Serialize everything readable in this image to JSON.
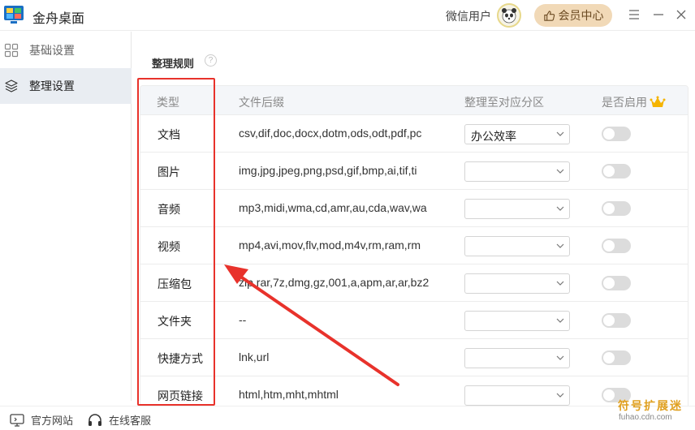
{
  "app": {
    "title": "金舟桌面"
  },
  "header": {
    "user_name": "微信用户",
    "vip_label": "会员中心"
  },
  "sidebar": {
    "items": [
      {
        "label": "基础设置",
        "icon": "grid-icon",
        "active": false
      },
      {
        "label": "整理设置",
        "icon": "layers-icon",
        "active": true
      }
    ]
  },
  "main": {
    "section_title": "整理规则",
    "columns": {
      "type": "类型",
      "ext": "文件后缀",
      "zone": "整理至对应分区",
      "enabled": "是否启用"
    },
    "rows": [
      {
        "type": "文档",
        "ext": "csv,dif,doc,docx,dotm,ods,odt,pdf,pc",
        "zone": "办公效率",
        "enabled": false
      },
      {
        "type": "图片",
        "ext": "img,jpg,jpeg,png,psd,gif,bmp,ai,tif,ti",
        "zone": "",
        "enabled": false
      },
      {
        "type": "音频",
        "ext": "mp3,midi,wma,cd,amr,au,cda,wav,wa",
        "zone": "",
        "enabled": false
      },
      {
        "type": "视频",
        "ext": "mp4,avi,mov,flv,mod,m4v,rm,ram,rm",
        "zone": "",
        "enabled": false
      },
      {
        "type": "压缩包",
        "ext": "zip,rar,7z,dmg,gz,001,a,apm,ar,ar,bz2",
        "zone": "",
        "enabled": false
      },
      {
        "type": "文件夹",
        "ext": "--",
        "zone": "",
        "enabled": false
      },
      {
        "type": "快捷方式",
        "ext": "lnk,url",
        "zone": "",
        "enabled": false
      },
      {
        "type": "网页链接",
        "ext": "html,htm,mht,mhtml",
        "zone": "",
        "enabled": false
      }
    ]
  },
  "footer": {
    "website": "官方网站",
    "support": "在线客服"
  },
  "watermark": {
    "text": "符号扩展迷",
    "sub": "fuhao.cdn.com"
  },
  "colors": {
    "annotation": "#e8322b",
    "vip_bg": "#f1d9b7",
    "active_bg": "#e9edf2"
  }
}
